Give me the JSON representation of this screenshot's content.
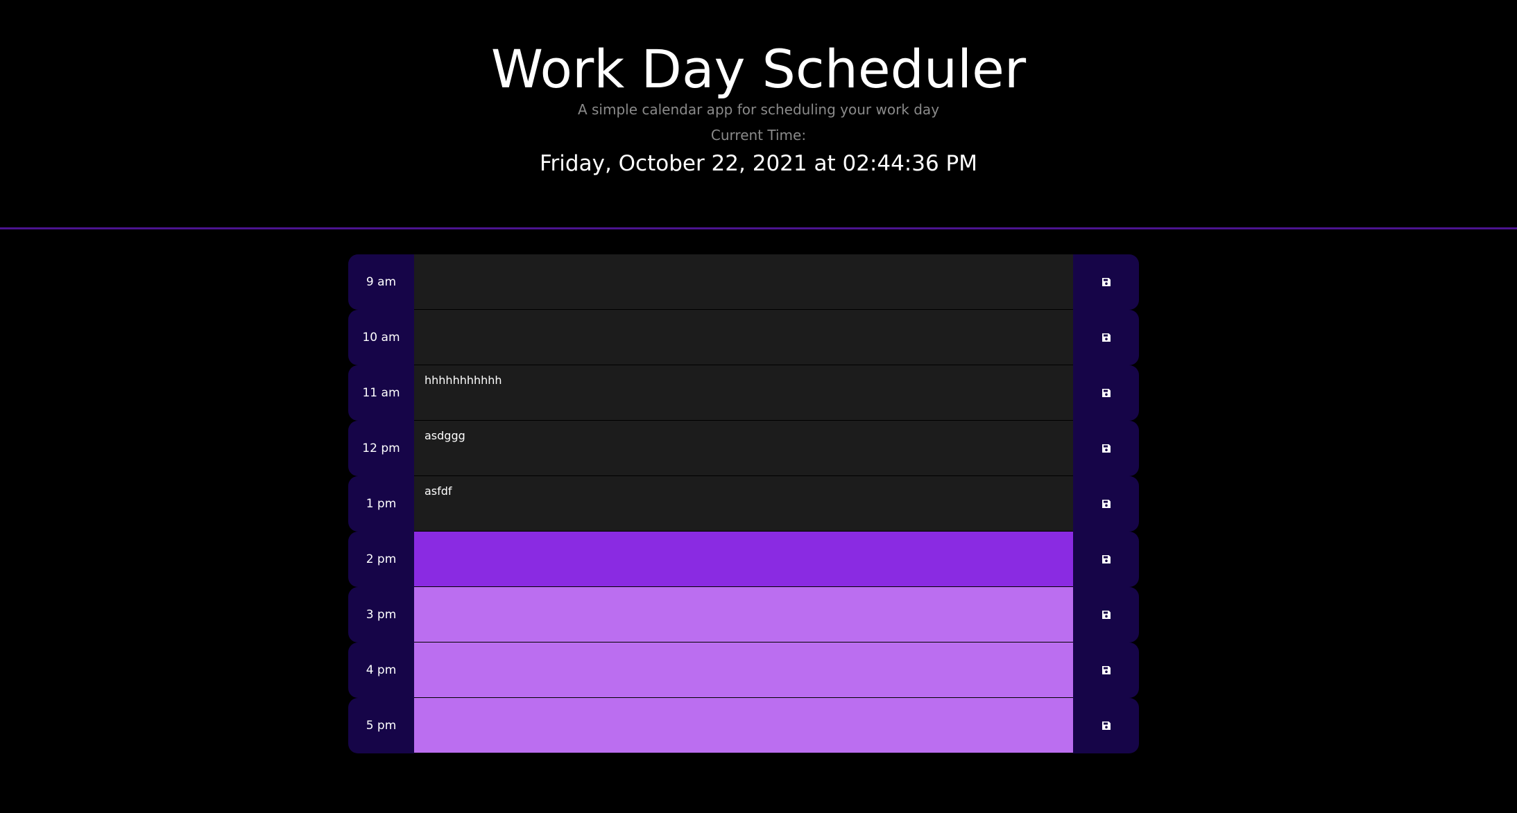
{
  "header": {
    "title": "Work Day Scheduler",
    "subtitle": "A simple calendar app for scheduling your work day",
    "time_label": "Current Time:",
    "current_time": "Friday, October 22, 2021 at 02:44:36 PM"
  },
  "colors": {
    "background": "#000000",
    "divider": "#4b148f",
    "hour_block": "#160548",
    "past": "#1c1c1c",
    "present": "#8a2be2",
    "future": "#bb6ef0"
  },
  "timeblocks": [
    {
      "hour": "9 am",
      "text": "",
      "state": "past",
      "save_icon": "floppy-disk-icon"
    },
    {
      "hour": "10 am",
      "text": "",
      "state": "past",
      "save_icon": "floppy-disk-icon"
    },
    {
      "hour": "11 am",
      "text": "hhhhhhhhhhh",
      "state": "past",
      "save_icon": "floppy-disk-icon"
    },
    {
      "hour": "12 pm",
      "text": "asdggg",
      "state": "past",
      "save_icon": "floppy-disk-icon"
    },
    {
      "hour": "1 pm",
      "text": "asfdf",
      "state": "past",
      "save_icon": "floppy-disk-icon"
    },
    {
      "hour": "2 pm",
      "text": "",
      "state": "present",
      "save_icon": "floppy-disk-icon"
    },
    {
      "hour": "3 pm",
      "text": "",
      "state": "future",
      "save_icon": "floppy-disk-icon"
    },
    {
      "hour": "4 pm",
      "text": "",
      "state": "future",
      "save_icon": "floppy-disk-icon"
    },
    {
      "hour": "5 pm",
      "text": "",
      "state": "future",
      "save_icon": "floppy-disk-icon"
    }
  ]
}
